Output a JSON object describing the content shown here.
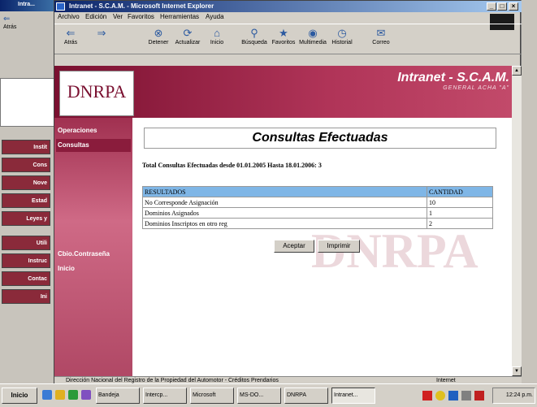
{
  "window": {
    "title": "Intranet - S.C.A.M. - Microsoft Internet Explorer",
    "minimize": "_",
    "maximize": "□",
    "close": "×"
  },
  "menu": [
    "Archivo",
    "Edición",
    "Ver",
    "Favoritos",
    "Herramientas",
    "Ayuda"
  ],
  "toolbar": [
    {
      "label": "Atrás",
      "icon": "back-arrow-icon",
      "glyph": "⇐"
    },
    {
      "label": "",
      "icon": "forward-arrow-icon",
      "glyph": "⇒"
    },
    {
      "label": "Detener",
      "icon": "stop-icon",
      "glyph": "⊗"
    },
    {
      "label": "Actualizar",
      "icon": "refresh-icon",
      "glyph": "⟳"
    },
    {
      "label": "Inicio",
      "icon": "home-icon",
      "glyph": "⌂"
    },
    {
      "label": "Búsqueda",
      "icon": "search-icon",
      "glyph": "⚲"
    },
    {
      "label": "Favoritos",
      "icon": "favorites-icon",
      "glyph": "★"
    },
    {
      "label": "Multimedia",
      "icon": "media-icon",
      "glyph": "◉"
    },
    {
      "label": "Historial",
      "icon": "history-icon",
      "glyph": "◷"
    },
    {
      "label": "Correo",
      "icon": "mail-icon",
      "glyph": "✉"
    }
  ],
  "site": {
    "logo": "DNRPA",
    "title": "Intranet - S.C.A.M.",
    "subtitle": "GENERAL ACHA \"A\""
  },
  "nav": {
    "operaciones": "Operaciones",
    "consultas": "Consultas",
    "cambio": "Cbio.Contraseña",
    "inicio": "Inicio"
  },
  "main": {
    "title": "Consultas Efectuadas",
    "summary": "Total Consultas Efectuadas desde 01.01.2005 Hasta 18.01.2006: 3",
    "table": {
      "headers": [
        "RESULTADOS",
        "CANTIDAD"
      ],
      "rows": [
        [
          "No Corresponde Asignación",
          "10"
        ],
        [
          "Dominios Asignados",
          "1"
        ],
        [
          "Dominios Inscriptos en otro reg",
          "2"
        ]
      ]
    },
    "accept_label": "Aceptar",
    "print_label": "Imprimir"
  },
  "watermark": "DNRPA",
  "status": {
    "text": "Dirección Nacional del Registro de la Propiedad del Automotor - Créditos Prendarios",
    "zone": "Internet"
  },
  "taskbar": {
    "start": "Inicio",
    "tasks": [
      "Bandeja",
      "Intercp...",
      "Microsoft",
      "MS-DO...",
      "DNRPA",
      "Intranet..."
    ],
    "clock": "12:24 p.m."
  },
  "left_window": {
    "title": "Intra...",
    "back": "Atrás",
    "buttons": [
      "Instit",
      "Cons",
      "Nove",
      "Estad",
      "Leyes y",
      "Utili",
      "Instruc",
      "Contac",
      "Ini"
    ]
  },
  "colors": {
    "header_maroon": "#7a1030",
    "table_header": "#7fb6e6",
    "title_blue": "#0a246a"
  }
}
